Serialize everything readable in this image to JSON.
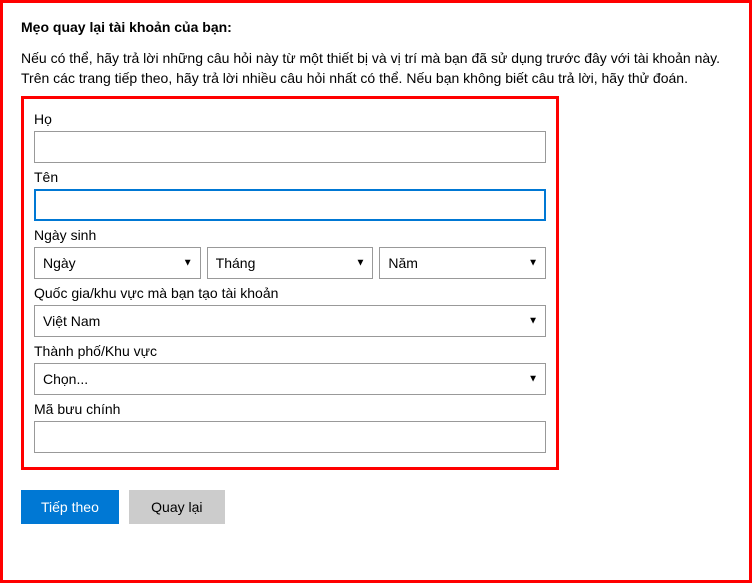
{
  "title": "Mẹo quay lại tài khoản của bạn:",
  "description": "Nếu có thể, hãy trả lời những câu hỏi này từ một thiết bị và vị trí mà bạn đã sử dụng trước đây với tài khoản này. Trên các trang tiếp theo, hãy trả lời nhiều câu hỏi nhất có thể. Nếu bạn không biết câu trả lời, hãy thử đoán.",
  "form": {
    "last_name_label": "Họ",
    "last_name_value": "",
    "first_name_label": "Tên",
    "first_name_value": "",
    "birthdate_label": "Ngày sinh",
    "day_label": "Ngày",
    "month_label": "Tháng",
    "year_label": "Năm",
    "country_label": "Quốc gia/khu vực mà bạn tạo tài khoản",
    "country_value": "Việt Nam",
    "city_label": "Thành phố/Khu vực",
    "city_value": "Chọn...",
    "postal_label": "Mã bưu chính",
    "postal_value": ""
  },
  "buttons": {
    "next": "Tiếp theo",
    "back": "Quay lại"
  }
}
